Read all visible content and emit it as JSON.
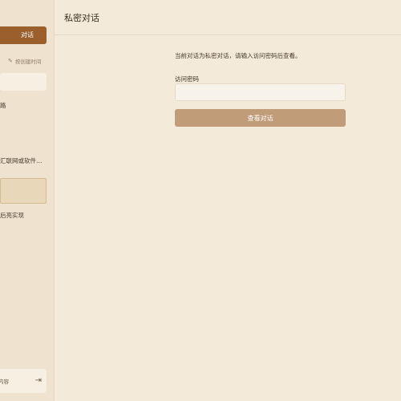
{
  "sidebar": {
    "new_chat_label": "对话",
    "sort_label": "按创建时间",
    "items": [
      {
        "label": "路"
      },
      {
        "label": "汇联网或软件…"
      },
      {
        "label": ""
      },
      {
        "label": "后亮实现"
      }
    ],
    "footer_label": "内容",
    "icons": {
      "sort": "pencil-icon",
      "footer": "exit-icon"
    }
  },
  "header": {
    "title": "私密对话"
  },
  "main": {
    "notice": "当前对话为私密对话，请输入访问密码后查看。",
    "password_label": "访问密码",
    "password_value": "",
    "password_placeholder": "",
    "view_button_label": "查看对话"
  },
  "colors": {
    "accent": "#9a5f2c",
    "button": "#c09c79",
    "background": "#f3ead9"
  }
}
